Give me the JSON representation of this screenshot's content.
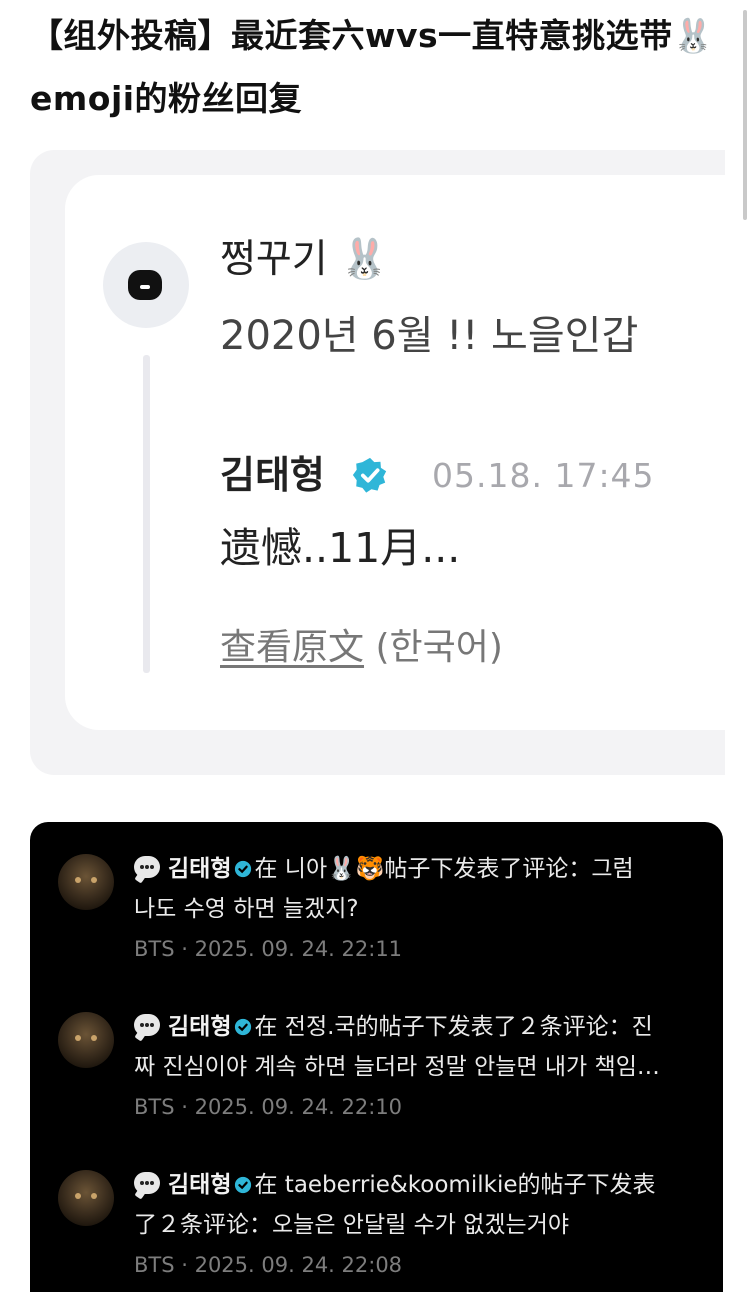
{
  "headline": "【组外投稿】最近套六wvs一直特意挑选带🐰emoji的粉丝回复",
  "colors": {
    "verified_badge": "#2fb6d8",
    "dark_panel_bg": "#000000",
    "card_bg": "#ffffff",
    "panel_bg": "#f3f3f5"
  },
  "post": {
    "author": "쩡꾸기 🐰",
    "text": "2020년 6월 !! 노을인갑",
    "icon": "chat-bubble-icon"
  },
  "reply": {
    "name": "김태형",
    "time": "05.18. 17:45",
    "text": "遗憾..11月...",
    "translate_link": "查看原文",
    "translate_lang": "(한국어)"
  },
  "comments": [
    {
      "name": "김태형",
      "line1_rest": "在 니아🐰🐯帖子下发表了评论：그럼",
      "line2": "나도 수영 하면 늘겠지?",
      "meta": "BTS · 2025. 09. 24. 22:11"
    },
    {
      "name": "김태형",
      "line1_rest": "在 전정.국的帖子下发表了２条评论：진",
      "line2": "짜 진심이야 계속 하면 늘더라 정말 안늘면 내가 책임…",
      "meta": "BTS · 2025. 09. 24. 22:10"
    },
    {
      "name": "김태형",
      "line1_rest": "在 taeberrie&koomilkie的帖子下发表",
      "line2": "了２条评论：오늘은 안달릴 수가 없겠는거야",
      "meta": "BTS · 2025. 09. 24. 22:08"
    }
  ]
}
